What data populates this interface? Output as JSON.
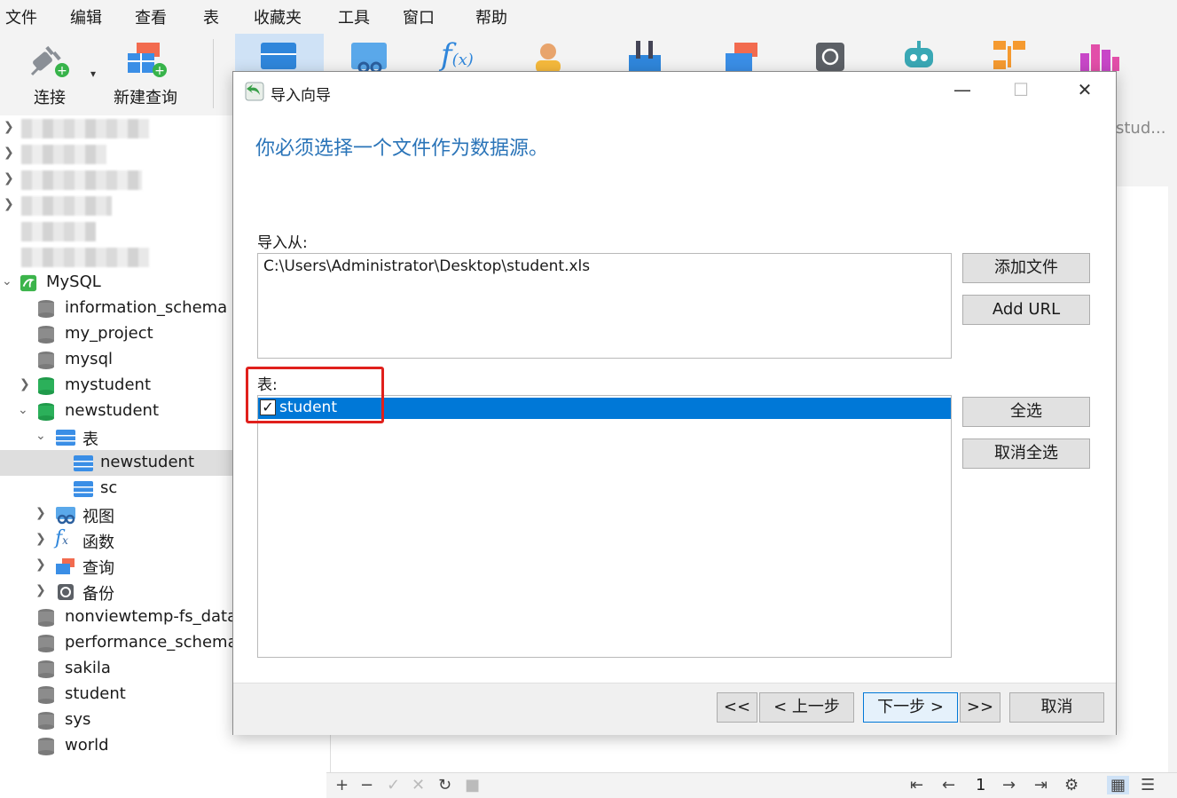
{
  "menu": [
    "文件",
    "编辑",
    "查看",
    "表",
    "收藏夹",
    "工具",
    "窗口",
    "帮助"
  ],
  "toolbar": {
    "connect_label": "连接",
    "new_query_label": "新建查询"
  },
  "tree": {
    "connection": "MySQL",
    "databases": [
      "information_schema",
      "my_project",
      "mysql",
      "mystudent",
      "newstudent"
    ],
    "tables_group": "表",
    "tables": [
      "newstudent",
      "sc"
    ],
    "groups": [
      "视图",
      "函数",
      "查询",
      "备份"
    ],
    "more_databases": [
      "nonviewtemp-fs_data_",
      "performance_schema",
      "sakila",
      "student",
      "sys",
      "world"
    ]
  },
  "right_tab_label": "stud...",
  "page_number": "1",
  "dialog": {
    "title": "导入向导",
    "heading": "你必须选择一个文件作为数据源。",
    "import_from_label": "导入从:",
    "file_path": "C:\\Users\\Administrator\\Desktop\\student.xls",
    "add_file_button": "添加文件",
    "add_url_button": "Add URL",
    "table_label": "表:",
    "table_item": "student",
    "table_item_checked": true,
    "select_all_button": "全选",
    "deselect_all_button": "取消全选",
    "first_button": "<<",
    "prev_button": "< 上一步",
    "next_button": "下一步 >",
    "last_button": ">>",
    "cancel_button": "取消"
  },
  "colors": {
    "accent": "#0078d7",
    "heading": "#2a74b8",
    "highlight_box": "#e0201c"
  }
}
